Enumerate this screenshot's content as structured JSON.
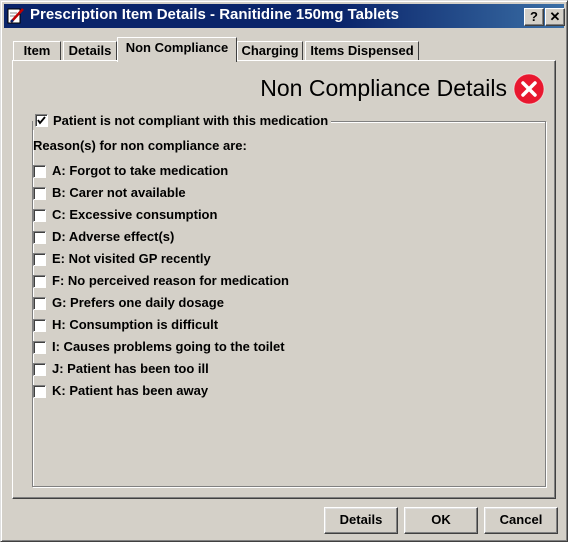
{
  "window": {
    "title": "Prescription Item Details - Ranitidine 150mg Tablets",
    "help_label": "?",
    "close_label": "✕"
  },
  "tabs": [
    {
      "label": "Item",
      "active": false
    },
    {
      "label": "Details",
      "active": false
    },
    {
      "label": "Non Compliance",
      "active": true
    },
    {
      "label": "Charging",
      "active": false
    },
    {
      "label": "Items Dispensed",
      "active": false
    }
  ],
  "panel": {
    "heading": "Non Compliance Details",
    "heading_icon": "error-x-icon",
    "accent_color": "#e8172f"
  },
  "group": {
    "legend_checked": true,
    "legend_label": "Patient is not compliant with this medication",
    "reasons_header": "Reason(s) for non compliance are:",
    "reasons": [
      {
        "label": "A: Forgot to take medication",
        "checked": false
      },
      {
        "label": "B: Carer not available",
        "checked": false
      },
      {
        "label": "C: Excessive consumption",
        "checked": false
      },
      {
        "label": "D: Adverse effect(s)",
        "checked": false
      },
      {
        "label": "E: Not visited GP recently",
        "checked": false
      },
      {
        "label": "F: No perceived reason for medication",
        "checked": false
      },
      {
        "label": "G: Prefers one daily dosage",
        "checked": false
      },
      {
        "label": "H: Consumption is difficult",
        "checked": false
      },
      {
        "label": "I: Causes problems going to the toilet",
        "checked": false
      },
      {
        "label": "J: Patient has been too ill",
        "checked": false
      },
      {
        "label": "K: Patient has been away",
        "checked": false
      }
    ]
  },
  "buttons": {
    "details_label": "Details",
    "ok_label": "OK",
    "cancel_label": "Cancel"
  }
}
